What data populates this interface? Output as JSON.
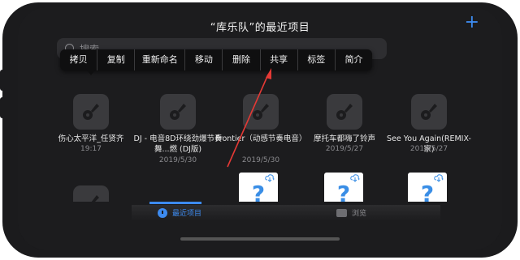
{
  "header": {
    "title": "“库乐队”的最近项目",
    "add_label": "+"
  },
  "search": {
    "placeholder": "搜索"
  },
  "context_menu": {
    "items": [
      "拷贝",
      "复制",
      "重新命名",
      "移动",
      "删除",
      "共享",
      "标签",
      "简介"
    ]
  },
  "projects": [
    {
      "name": "伤心太平洋_任贤齐",
      "date": "19:17"
    },
    {
      "name": "DJ - 电音8D环绕劲爆节奏舞...燃 (DJ版)",
      "date": "2019/5/30"
    },
    {
      "name": "Frontier（动感节奏电音）",
      "date": "2019/5/30"
    },
    {
      "name": "摩托车都嗨了铃声",
      "date": "2019/5/27"
    },
    {
      "name": "See You Again(REMIX-家)",
      "date": "2019/5/27"
    }
  ],
  "tabs": {
    "recent": "最近项目",
    "browse": "浏览"
  },
  "colors": {
    "accent": "#3d8bf0",
    "annotation_arrow": "#e53935",
    "background": "#1c1c1e"
  }
}
